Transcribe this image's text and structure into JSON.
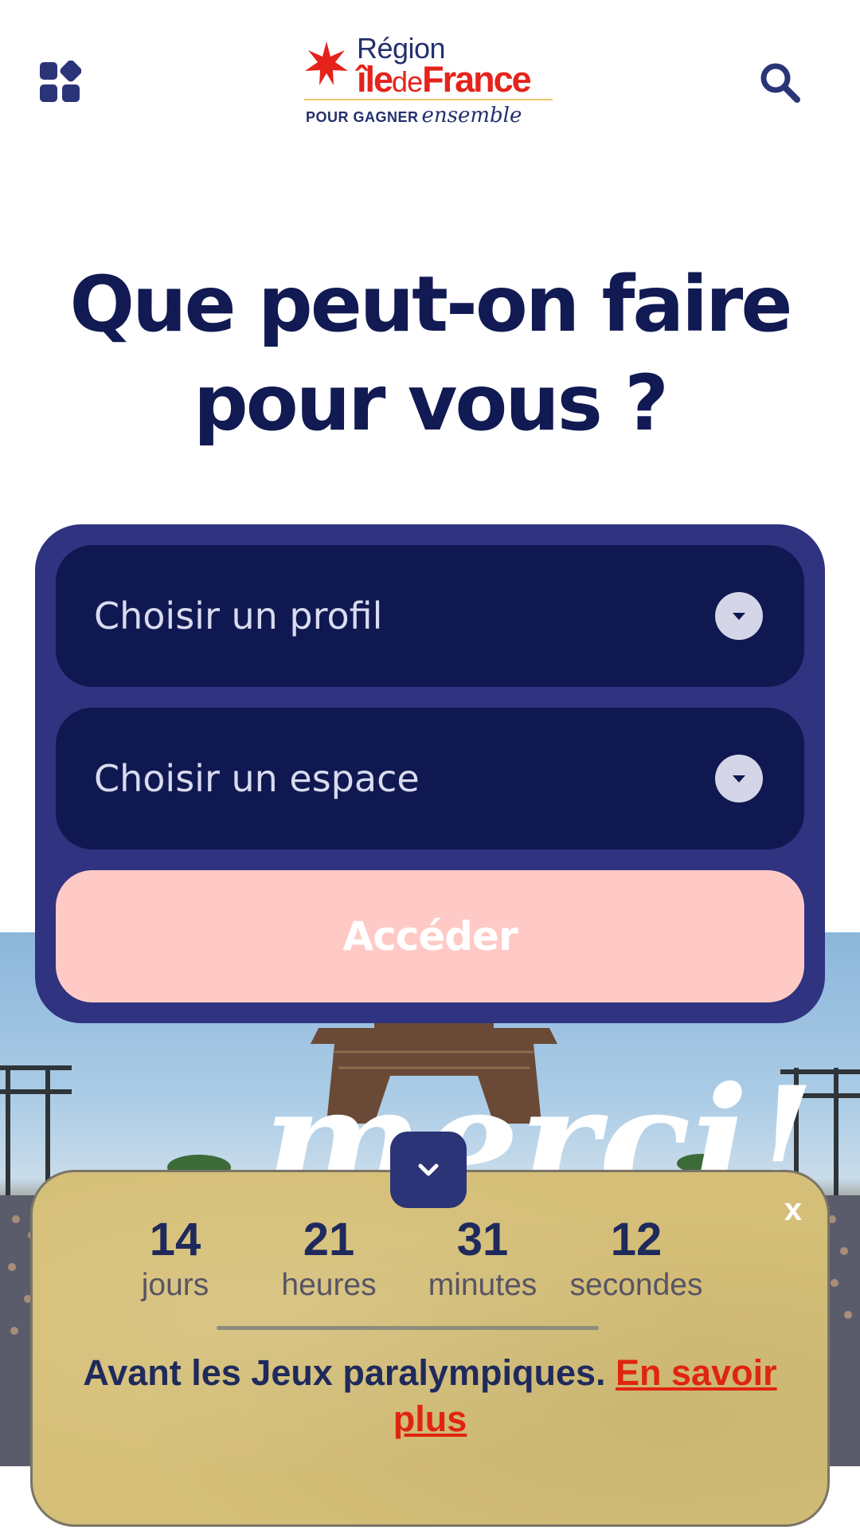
{
  "header": {
    "logo": {
      "region": "Région",
      "ile": "île",
      "de": "de",
      "france": "France",
      "tagline_caps": "POUR GAGNER",
      "tagline_script": "ensemble"
    },
    "icons": {
      "menu": "apps-grid-icon",
      "search": "search-icon"
    }
  },
  "headline": "Que peut-on faire pour vous ?",
  "selector": {
    "profile_placeholder": "Choisir un profil",
    "space_placeholder": "Choisir un espace",
    "submit_label": "Accéder"
  },
  "countdown": {
    "units": [
      {
        "value": "14",
        "label": "jours"
      },
      {
        "value": "21",
        "label": "heures"
      },
      {
        "value": "31",
        "label": "minutes"
      },
      {
        "value": "12",
        "label": "secondes"
      }
    ],
    "message": "Avant les Jeux paralympiques.",
    "link_label": "En savoir plus",
    "close_label": "x"
  },
  "hero": {
    "caption": "merci!"
  },
  "colors": {
    "navy": "#111a52",
    "card": "#2f3380",
    "select": "#101851",
    "button": "#ffcac6",
    "banner": "#d5bf78",
    "red": "#e5231b"
  }
}
